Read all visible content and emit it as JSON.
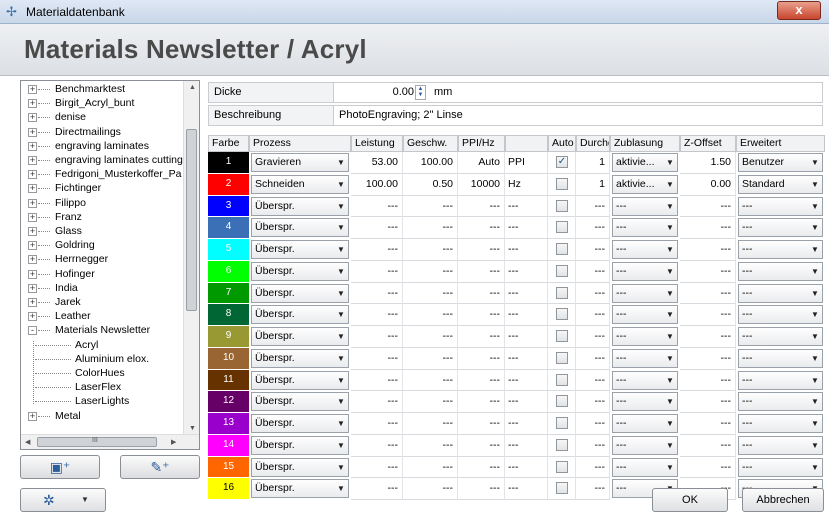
{
  "window": {
    "title": "Materialdatenbank",
    "close_label": "x"
  },
  "page_title": "Materials Newsletter / Acryl",
  "tree": {
    "items": [
      {
        "label": "Benchmarktest",
        "level": 0,
        "expander": "+"
      },
      {
        "label": "Birgit_Acryl_bunt",
        "level": 0,
        "expander": "+"
      },
      {
        "label": "denise",
        "level": 0,
        "expander": "+"
      },
      {
        "label": "Directmailings",
        "level": 0,
        "expander": "+"
      },
      {
        "label": "engraving laminates",
        "level": 0,
        "expander": "+"
      },
      {
        "label": "engraving laminates cutting",
        "level": 0,
        "expander": "+"
      },
      {
        "label": "Fedrigoni_Musterkoffer_Pa",
        "level": 0,
        "expander": "+"
      },
      {
        "label": "Fichtinger",
        "level": 0,
        "expander": "+"
      },
      {
        "label": "Filippo",
        "level": 0,
        "expander": "+"
      },
      {
        "label": "Franz",
        "level": 0,
        "expander": "+"
      },
      {
        "label": "Glass",
        "level": 0,
        "expander": "+"
      },
      {
        "label": "Goldring",
        "level": 0,
        "expander": "+"
      },
      {
        "label": "Herrnegger",
        "level": 0,
        "expander": "+"
      },
      {
        "label": "Hofinger",
        "level": 0,
        "expander": "+"
      },
      {
        "label": "India",
        "level": 0,
        "expander": "+"
      },
      {
        "label": "Jarek",
        "level": 0,
        "expander": "+"
      },
      {
        "label": "Leather",
        "level": 0,
        "expander": "+"
      },
      {
        "label": "Materials Newsletter",
        "level": 0,
        "expander": "-"
      },
      {
        "label": "Acryl",
        "level": 1,
        "expander": ""
      },
      {
        "label": "Aluminium elox.",
        "level": 1,
        "expander": ""
      },
      {
        "label": "ColorHues",
        "level": 1,
        "expander": ""
      },
      {
        "label": "LaserFlex",
        "level": 1,
        "expander": ""
      },
      {
        "label": "LaserLights",
        "level": 1,
        "expander": ""
      },
      {
        "label": "Metal",
        "level": 0,
        "expander": "+"
      }
    ],
    "hscroll_grip": "III"
  },
  "fields": {
    "dicke_label": "Dicke",
    "dicke_value": "0.00",
    "dicke_unit": "mm",
    "beschreibung_label": "Beschreibung",
    "beschreibung_value": "PhotoEngraving; 2\" Linse"
  },
  "table": {
    "headers": [
      "Farbe",
      "Prozess",
      "Leistung",
      "Geschw.",
      "PPI/Hz",
      "",
      "Auto",
      "Durchg.",
      "Zublasung",
      "Z-Offset",
      "Erweitert"
    ],
    "rows": [
      {
        "farbe": "1",
        "color": "#000000",
        "text_color": "#ffffff",
        "prozess": "Gravieren",
        "leistung": "53.00",
        "geschw": "100.00",
        "ppi": "Auto",
        "unit": "PPI",
        "auto": true,
        "durchg": "1",
        "zublasung": "aktivie...",
        "zoffset": "1.50",
        "erweitert": "Benutzer"
      },
      {
        "farbe": "2",
        "color": "#ff0000",
        "text_color": "#ffffff",
        "prozess": "Schneiden",
        "leistung": "100.00",
        "geschw": "0.50",
        "ppi": "10000",
        "unit": "Hz",
        "auto": false,
        "durchg": "1",
        "zublasung": "aktivie...",
        "zoffset": "0.00",
        "erweitert": "Standard"
      },
      {
        "farbe": "3",
        "color": "#0000ff",
        "text_color": "#ffffff",
        "prozess": "Überspr.",
        "leistung": "---",
        "geschw": "---",
        "ppi": "---",
        "unit": "---",
        "auto": false,
        "durchg": "---",
        "zublasung": "---",
        "zoffset": "---",
        "erweitert": "---"
      },
      {
        "farbe": "4",
        "color": "#3b6fb6",
        "text_color": "#ffffff",
        "prozess": "Überspr.",
        "leistung": "---",
        "geschw": "---",
        "ppi": "---",
        "unit": "---",
        "auto": false,
        "durchg": "---",
        "zublasung": "---",
        "zoffset": "---",
        "erweitert": "---"
      },
      {
        "farbe": "5",
        "color": "#00ffff",
        "text_color": "#ffffff",
        "prozess": "Überspr.",
        "leistung": "---",
        "geschw": "---",
        "ppi": "---",
        "unit": "---",
        "auto": false,
        "durchg": "---",
        "zublasung": "---",
        "zoffset": "---",
        "erweitert": "---"
      },
      {
        "farbe": "6",
        "color": "#00ff00",
        "text_color": "#ffffff",
        "prozess": "Überspr.",
        "leistung": "---",
        "geschw": "---",
        "ppi": "---",
        "unit": "---",
        "auto": false,
        "durchg": "---",
        "zublasung": "---",
        "zoffset": "---",
        "erweitert": "---"
      },
      {
        "farbe": "7",
        "color": "#009900",
        "text_color": "#ffffff",
        "prozess": "Überspr.",
        "leistung": "---",
        "geschw": "---",
        "ppi": "---",
        "unit": "---",
        "auto": false,
        "durchg": "---",
        "zublasung": "---",
        "zoffset": "---",
        "erweitert": "---"
      },
      {
        "farbe": "8",
        "color": "#006633",
        "text_color": "#ffffff",
        "prozess": "Überspr.",
        "leistung": "---",
        "geschw": "---",
        "ppi": "---",
        "unit": "---",
        "auto": false,
        "durchg": "---",
        "zublasung": "---",
        "zoffset": "---",
        "erweitert": "---"
      },
      {
        "farbe": "9",
        "color": "#999933",
        "text_color": "#ffffff",
        "prozess": "Überspr.",
        "leistung": "---",
        "geschw": "---",
        "ppi": "---",
        "unit": "---",
        "auto": false,
        "durchg": "---",
        "zublasung": "---",
        "zoffset": "---",
        "erweitert": "---"
      },
      {
        "farbe": "10",
        "color": "#996633",
        "text_color": "#ffffff",
        "prozess": "Überspr.",
        "leistung": "---",
        "geschw": "---",
        "ppi": "---",
        "unit": "---",
        "auto": false,
        "durchg": "---",
        "zublasung": "---",
        "zoffset": "---",
        "erweitert": "---"
      },
      {
        "farbe": "11",
        "color": "#663300",
        "text_color": "#ffffff",
        "prozess": "Überspr.",
        "leistung": "---",
        "geschw": "---",
        "ppi": "---",
        "unit": "---",
        "auto": false,
        "durchg": "---",
        "zublasung": "---",
        "zoffset": "---",
        "erweitert": "---"
      },
      {
        "farbe": "12",
        "color": "#660066",
        "text_color": "#ffffff",
        "prozess": "Überspr.",
        "leistung": "---",
        "geschw": "---",
        "ppi": "---",
        "unit": "---",
        "auto": false,
        "durchg": "---",
        "zublasung": "---",
        "zoffset": "---",
        "erweitert": "---"
      },
      {
        "farbe": "13",
        "color": "#9900cc",
        "text_color": "#ffffff",
        "prozess": "Überspr.",
        "leistung": "---",
        "geschw": "---",
        "ppi": "---",
        "unit": "---",
        "auto": false,
        "durchg": "---",
        "zublasung": "---",
        "zoffset": "---",
        "erweitert": "---"
      },
      {
        "farbe": "14",
        "color": "#ff00ff",
        "text_color": "#ffffff",
        "prozess": "Überspr.",
        "leistung": "---",
        "geschw": "---",
        "ppi": "---",
        "unit": "---",
        "auto": false,
        "durchg": "---",
        "zublasung": "---",
        "zoffset": "---",
        "erweitert": "---"
      },
      {
        "farbe": "15",
        "color": "#ff6600",
        "text_color": "#ffffff",
        "prozess": "Überspr.",
        "leistung": "---",
        "geschw": "---",
        "ppi": "---",
        "unit": "---",
        "auto": false,
        "durchg": "---",
        "zublasung": "---",
        "zoffset": "---",
        "erweitert": "---"
      },
      {
        "farbe": "16",
        "color": "#ffff00",
        "text_color": "#000000",
        "prozess": "Überspr.",
        "leistung": "---",
        "geschw": "---",
        "ppi": "---",
        "unit": "---",
        "auto": false,
        "durchg": "---",
        "zublasung": "---",
        "zoffset": "---",
        "erweitert": "---"
      }
    ]
  },
  "buttons": {
    "ok": "OK",
    "cancel": "Abbrechen"
  },
  "icons": {
    "app": "laser-icon",
    "add_material": "add-material-icon",
    "add_folder": "add-folder-icon",
    "settings": "gear-icon"
  }
}
